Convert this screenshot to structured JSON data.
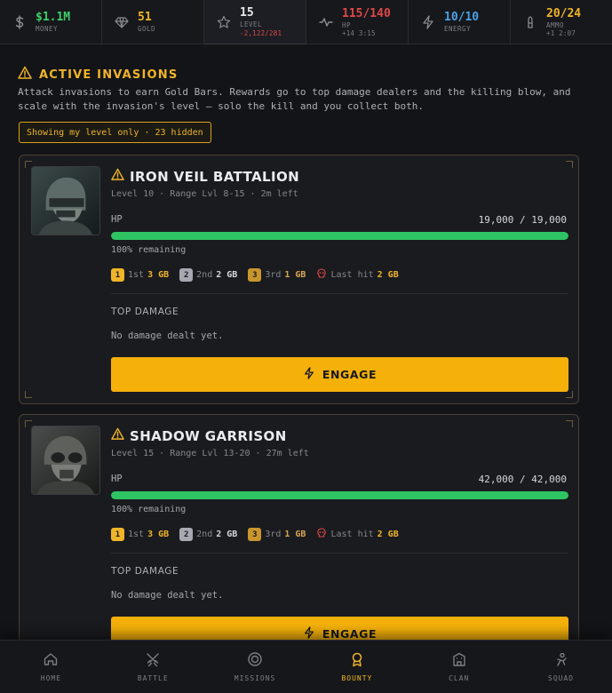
{
  "stats": [
    {
      "value": "$1.1M",
      "label": "MONEY",
      "sub": "",
      "icon": "dollar-icon",
      "color": "#3fd06a"
    },
    {
      "value": "51",
      "label": "GOLD",
      "sub": "",
      "icon": "gem-icon",
      "color": "#f0b429"
    },
    {
      "value": "15",
      "label": "LEVEL",
      "sub": "-2,122/281",
      "icon": "star-icon",
      "color": "#e8e8ea"
    },
    {
      "value": "115/140",
      "label": "HP",
      "sub": "+14 3:15",
      "icon": "pulse-icon",
      "color": "#e04848"
    },
    {
      "value": "10/10",
      "label": "ENERGY",
      "sub": "",
      "icon": "bolt-icon",
      "color": "#4aa3e6"
    },
    {
      "value": "20/24",
      "label": "AMMO",
      "sub": "+1 2:07",
      "icon": "bullet-icon",
      "color": "#f0b429"
    }
  ],
  "section": {
    "title": "ACTIVE INVASIONS",
    "intro": "Attack invasions to earn Gold Bars. Rewards go to top damage dealers and the killing blow, and scale with the invasion's level — solo the kill and you collect both.",
    "filter": "Showing my level only · 23 hidden"
  },
  "invasions": [
    {
      "name": "IRON VEIL BATTALION",
      "meta": "Level 10 · Range Lvl 8-15 · 2m left",
      "hp_label": "HP",
      "hp_value": "19,000 / 19,000",
      "hp_fraction": 1.0,
      "remaining": "100% remaining",
      "rewards": {
        "first_rank": "1",
        "first_label": "1st",
        "first_amt": "3 GB",
        "second_rank": "2",
        "second_label": "2nd",
        "second_amt": "2 GB",
        "third_rank": "3",
        "third_label": "3rd",
        "third_amt": "1 GB",
        "last_label": "Last hit",
        "last_amt": "2 GB"
      },
      "top_damage_heading": "TOP DAMAGE",
      "top_damage_empty": "No damage dealt yet.",
      "engage_label": "ENGAGE"
    },
    {
      "name": "SHADOW GARRISON",
      "meta": "Level 15 · Range Lvl 13-20 · 27m left",
      "hp_label": "HP",
      "hp_value": "42,000 / 42,000",
      "hp_fraction": 1.0,
      "remaining": "100% remaining",
      "rewards": {
        "first_rank": "1",
        "first_label": "1st",
        "first_amt": "3 GB",
        "second_rank": "2",
        "second_label": "2nd",
        "second_amt": "2 GB",
        "third_rank": "3",
        "third_label": "3rd",
        "third_amt": "1 GB",
        "last_label": "Last hit",
        "last_amt": "2 GB"
      },
      "top_damage_heading": "TOP DAMAGE",
      "top_damage_empty": "No damage dealt yet.",
      "engage_label": "ENGAGE"
    }
  ],
  "nav": [
    {
      "label": "HOME",
      "icon": "home-icon",
      "active": false
    },
    {
      "label": "BATTLE",
      "icon": "swords-icon",
      "active": false
    },
    {
      "label": "MISSIONS",
      "icon": "target-icon",
      "active": false
    },
    {
      "label": "BOUNTY",
      "icon": "medal-icon",
      "active": true
    },
    {
      "label": "CLAN",
      "icon": "fortress-icon",
      "active": false
    },
    {
      "label": "SQUAD",
      "icon": "squad-icon",
      "active": false
    }
  ],
  "colors": {
    "accent": "#f0b429",
    "hp_bar": "#2ec464",
    "background": "#131417"
  }
}
